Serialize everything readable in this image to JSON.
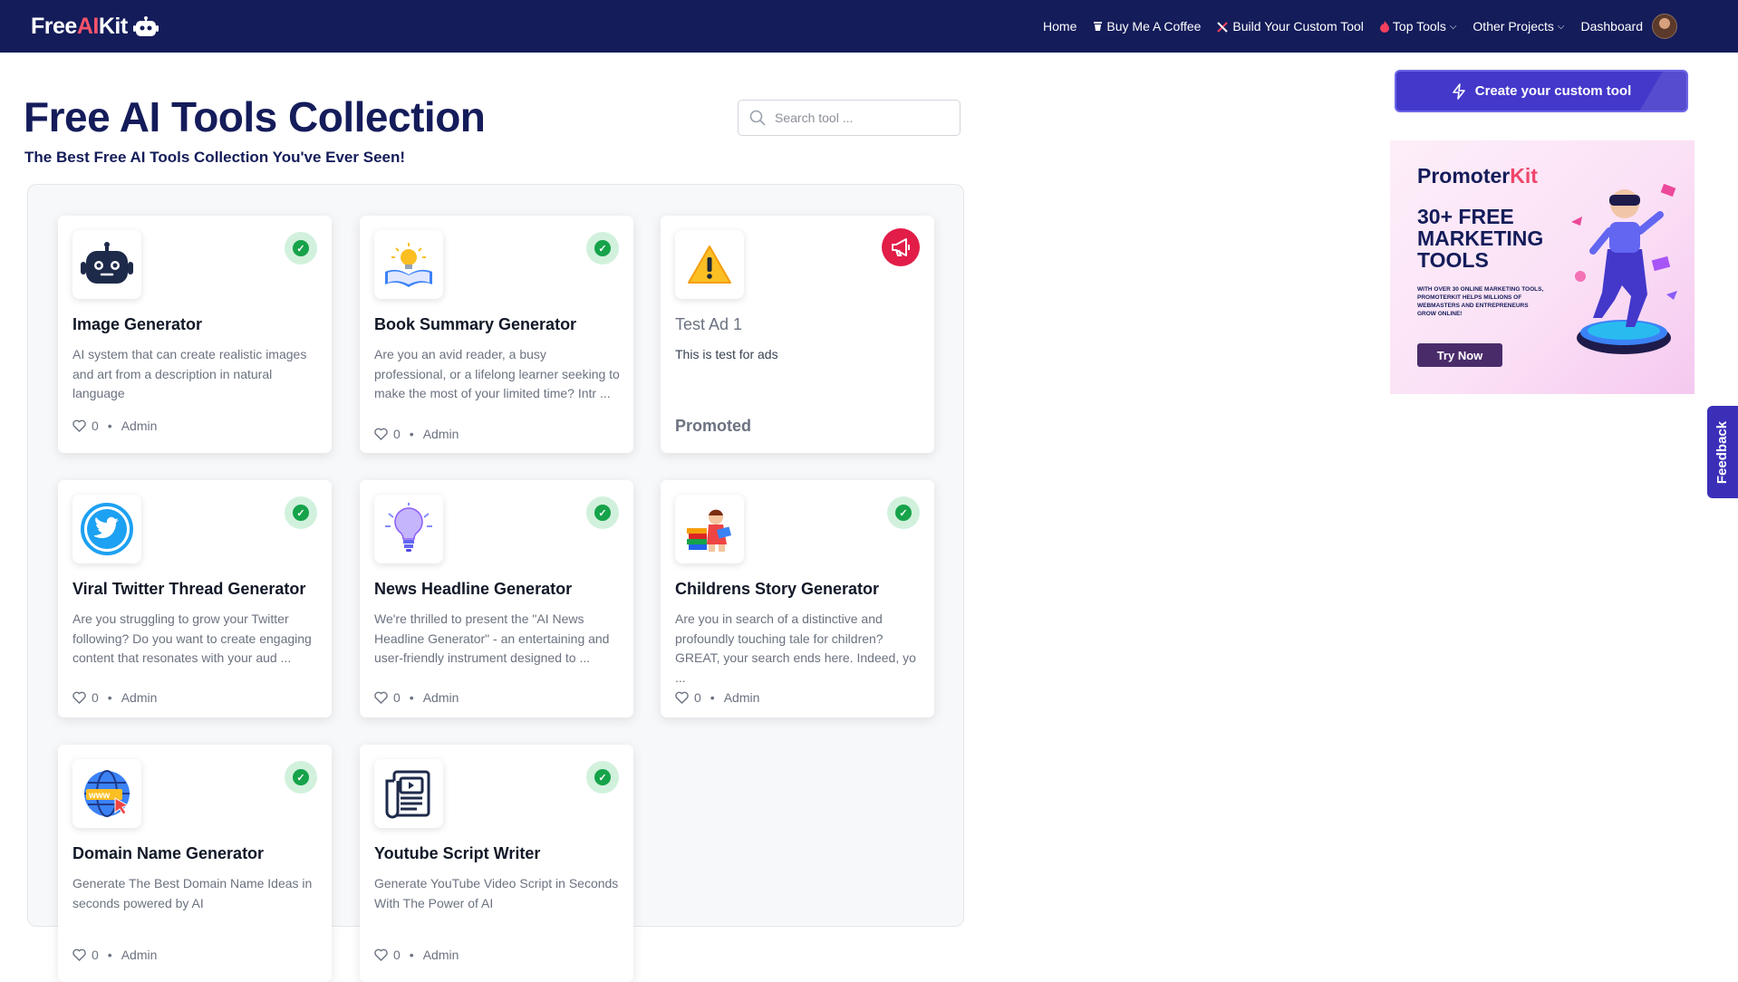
{
  "brand": {
    "logo_prefix": "Free",
    "logo_ai": "AI",
    "logo_suffix": "Kit"
  },
  "nav": {
    "home": "Home",
    "buy_coffee": "Buy Me A Coffee",
    "build_tool": "Build Your Custom Tool",
    "top_tools": "Top Tools",
    "other_projects": "Other Projects",
    "dashboard": "Dashboard"
  },
  "header": {
    "title": "Free AI Tools Collection",
    "subtitle": "The Best Free AI Tools Collection You've Ever Seen!"
  },
  "search": {
    "placeholder": "Search tool ..."
  },
  "cta": {
    "label": "Create your custom tool"
  },
  "cards": [
    {
      "title": "Image Generator",
      "desc": "AI system that can create realistic images and art from a description in natural language",
      "likes": "0",
      "author": "Admin"
    },
    {
      "title": "Book Summary Generator",
      "desc": "Are you an avid reader, a busy professional, or a lifelong learner seeking to make the most of your limited time? Intr ...",
      "likes": "0",
      "author": "Admin"
    },
    {
      "title": "Test Ad 1",
      "desc": "This is test for ads",
      "promoted": "Promoted"
    },
    {
      "title": "Viral Twitter Thread Generator",
      "desc": "Are you struggling to grow your Twitter following? Do you want to create engaging content that resonates with your aud ...",
      "likes": "0",
      "author": "Admin"
    },
    {
      "title": "News Headline Generator",
      "desc": "We're thrilled to present the \"AI News Headline Generator\" - an entertaining and user-friendly instrument designed to ...",
      "likes": "0",
      "author": "Admin"
    },
    {
      "title": "Childrens Story Generator",
      "desc": "Are you in search of a distinctive and profoundly touching tale for children? GREAT, your search ends here. Indeed, yo ...",
      "likes": "0",
      "author": "Admin"
    },
    {
      "title": "Domain Name Generator",
      "desc": "Generate The Best Domain Name Ideas in seconds powered by AI",
      "likes": "0",
      "author": "Admin"
    },
    {
      "title": "Youtube Script Writer",
      "desc": "Generate YouTube Video Script in Seconds With The Power of AI",
      "likes": "0",
      "author": "Admin"
    }
  ],
  "ad": {
    "brand_prefix": "Promoter",
    "brand_suffix": "Kit",
    "headline": "30+ FREE MARKETING TOOLS",
    "small": "WITH OVER 30 ONLINE MARKETING TOOLS, PROMOTERKIT HELPS MILLIONS OF WEBMASTERS AND ENTREPRENEURS GROW ONLINE!",
    "button": "Try Now"
  },
  "feedback": {
    "label": "Feedback"
  },
  "colors": {
    "navbar": "#141c5a",
    "accent": "#4338ca",
    "logo_ai": "#f8546b",
    "verified": "#16a34a",
    "promo": "#e11d48"
  }
}
